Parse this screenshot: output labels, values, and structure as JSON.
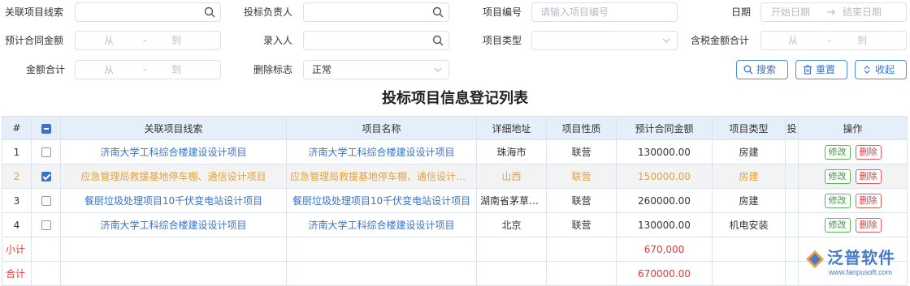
{
  "filters": {
    "related_lead": {
      "label": "关联项目线索",
      "value": ""
    },
    "bid_owner": {
      "label": "投标负责人",
      "value": ""
    },
    "project_no": {
      "label": "项目编号",
      "placeholder": "请输入项目编号"
    },
    "date": {
      "label": "日期",
      "start_placeholder": "开始日期",
      "end_placeholder": "结束日期"
    },
    "est_contract_amount": {
      "label": "预计合同金额",
      "from": "从",
      "sep": "-",
      "to": "到"
    },
    "entered_by": {
      "label": "录入人",
      "value": ""
    },
    "project_type": {
      "label": "项目类型",
      "value": ""
    },
    "tax_amount_total": {
      "label": "含税金额合计",
      "from": "从",
      "sep": "-",
      "to": "到"
    },
    "amount_total": {
      "label": "金额合计",
      "from": "从",
      "sep": "-",
      "to": "到"
    },
    "delete_flag": {
      "label": "删除标志",
      "value": "正常"
    }
  },
  "buttons": {
    "search": "搜索",
    "reset": "重置",
    "collapse": "收起"
  },
  "title": "投标项目信息登记列表",
  "table": {
    "columns": [
      "#",
      "关联项目线索",
      "项目名称",
      "详细地址",
      "项目性质",
      "预计合同金额",
      "项目类型",
      "投",
      "操作"
    ],
    "rows": [
      {
        "index": "1",
        "checked": false,
        "lead": "济南大学工科综合楼建设设计项目",
        "name": "济南大学工科综合楼建设设计项目",
        "address": "珠海市",
        "nature": "联营",
        "amount": "130000.00",
        "type": "房建"
      },
      {
        "index": "2",
        "checked": true,
        "lead": "应急管理局救援基地停车棚、通信设计项目",
        "name": "应急管理局救援基地停车棚、通信设计项目",
        "address": "山西",
        "nature": "联营",
        "amount": "150000.00",
        "type": "房建"
      },
      {
        "index": "3",
        "checked": false,
        "lead": "餐厨垃圾处理项目10千伏变电站设计项目",
        "name": "餐厨垃圾处理项目10千伏变电站设计项目",
        "address": "湖南省茅草街洞庭湖",
        "nature": "联营",
        "amount": "260000.00",
        "type": "房建"
      },
      {
        "index": "4",
        "checked": false,
        "lead": "济南大学工科综合楼建设设计项目",
        "name": "济南大学工科综合楼建设设计项目",
        "address": "北京",
        "nature": "联营",
        "amount": "130000.00",
        "type": "机电安装"
      }
    ],
    "ops": {
      "edit": "修改",
      "delete": "删除"
    },
    "subtotal": {
      "label": "小计",
      "amount": "670,000"
    },
    "total": {
      "label": "合计",
      "amount": "670000.00"
    }
  },
  "logo": {
    "name": "泛普软件",
    "url": "www.fanpusoft.com"
  },
  "colors": {
    "accent": "#3a73c7",
    "selected_text": "#e6a23c",
    "danger": "#e53935",
    "header_bg": "#e6eefa"
  }
}
